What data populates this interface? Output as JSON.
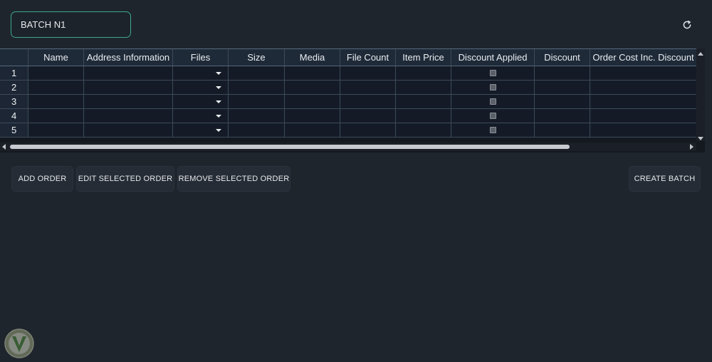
{
  "batch": {
    "value": "BATCH N1"
  },
  "refresh_icon": "refresh-icon",
  "table": {
    "columns": [
      "",
      "Name",
      "Address Information",
      "Files",
      "Size",
      "Media",
      "File Count",
      "Item Price",
      "Discount Applied",
      "Discount",
      "Order Cost Inc. Discount"
    ],
    "rows": [
      {
        "num": "1",
        "discount_applied": false
      },
      {
        "num": "2",
        "discount_applied": false
      },
      {
        "num": "3",
        "discount_applied": false
      },
      {
        "num": "4",
        "discount_applied": false
      },
      {
        "num": "5",
        "discount_applied": false
      }
    ]
  },
  "actions": {
    "add": "ADD ORDER",
    "edit": "EDIT SELECTED ORDER",
    "remove": "REMOVE SELECTED ORDER",
    "create": "CREATE BATCH"
  },
  "colors": {
    "accent": "#3aa88e",
    "background": "#1f252d",
    "grid": "#141b27"
  }
}
